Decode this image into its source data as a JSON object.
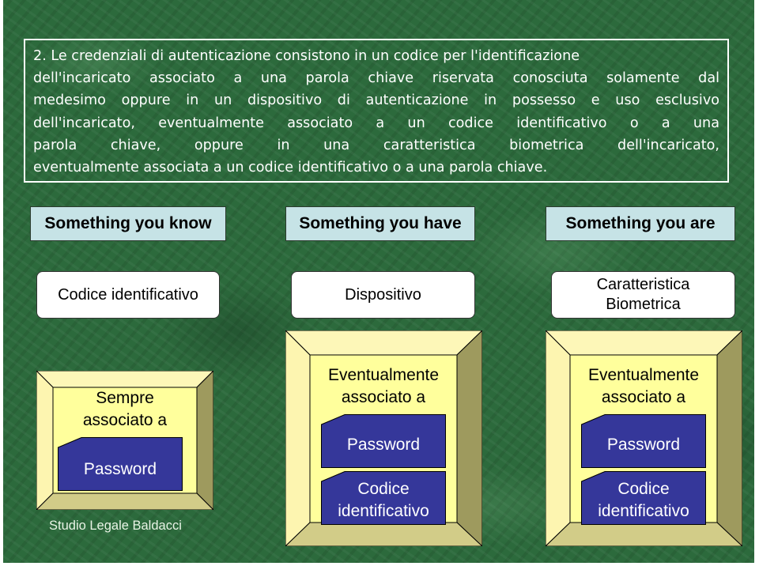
{
  "intro": {
    "lines": [
      "2. Le credenziali di autenticazione consistono in un codice per l'identificazione",
      "dell'incaricato associato a una parola chiave riservata conosciuta solamente dal",
      "medesimo oppure in un dispositivo di autenticazione in possesso e uso esclusivo",
      "dell'incaricato, eventualmente associato a un codice identificativo o a una",
      "parola chiave, oppure in una caratteristica biometrica dell'incaricato,",
      "eventualmente associata a un codice identificativo o a una parola chiave."
    ]
  },
  "columns": [
    {
      "header": "Something you know",
      "item": "Codice identificativo",
      "frame_label_1": "Sempre",
      "frame_label_2": "associato a",
      "tags": [
        "Password"
      ]
    },
    {
      "header": "Something you have",
      "item": "Dispositivo",
      "frame_label_1": "Eventualmente",
      "frame_label_2": "associato a",
      "tags": [
        "Password",
        "Codice",
        "identificativo"
      ]
    },
    {
      "header": "Something you are",
      "item_line_1": "Caratteristica",
      "item_line_2": "Biometrica",
      "frame_label_1": "Eventualmente",
      "frame_label_2": "associato a",
      "tags": [
        "Password",
        "Codice",
        "identificativo"
      ]
    }
  ],
  "footer": "Studio Legale Baldacci",
  "colors": {
    "background": "#2c6a3c",
    "header_fill": "#c6e3e6",
    "frame_light": "#fdf7b8",
    "frame_inner": "#ffff9c",
    "frame_shadow": "#9e9a5e",
    "tag_fill": "#35379a"
  }
}
